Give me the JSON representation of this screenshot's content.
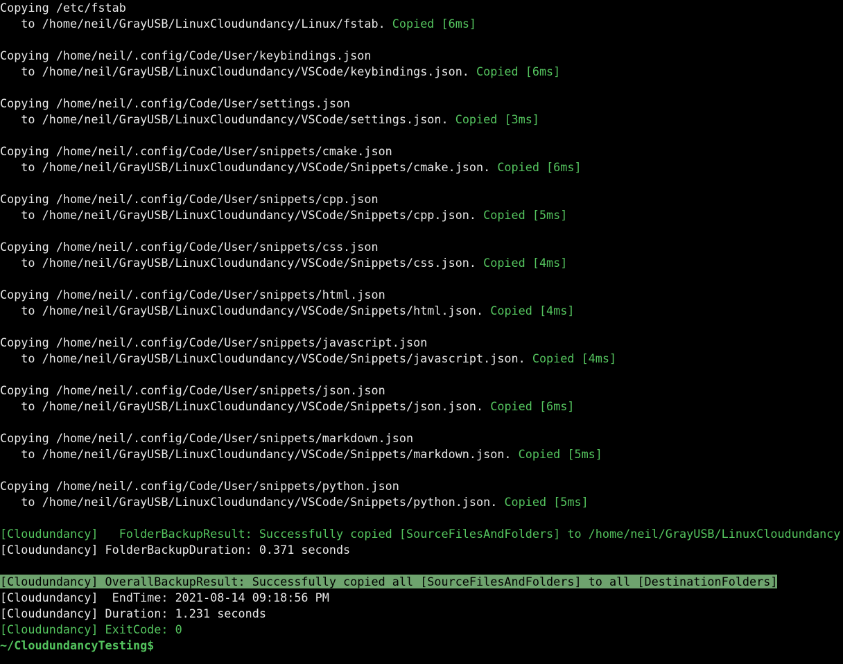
{
  "copies": [
    {
      "src": "Copying /etc/fstab",
      "dst": "   to /home/neil/GrayUSB/LinuxCloudundancy/Linux/fstab. ",
      "status": "Copied [6ms]"
    },
    {
      "src": "Copying /home/neil/.config/Code/User/keybindings.json",
      "dst": "   to /home/neil/GrayUSB/LinuxCloudundancy/VSCode/keybindings.json. ",
      "status": "Copied [6ms]"
    },
    {
      "src": "Copying /home/neil/.config/Code/User/settings.json",
      "dst": "   to /home/neil/GrayUSB/LinuxCloudundancy/VSCode/settings.json. ",
      "status": "Copied [3ms]"
    },
    {
      "src": "Copying /home/neil/.config/Code/User/snippets/cmake.json",
      "dst": "   to /home/neil/GrayUSB/LinuxCloudundancy/VSCode/Snippets/cmake.json. ",
      "status": "Copied [6ms]"
    },
    {
      "src": "Copying /home/neil/.config/Code/User/snippets/cpp.json",
      "dst": "   to /home/neil/GrayUSB/LinuxCloudundancy/VSCode/Snippets/cpp.json. ",
      "status": "Copied [5ms]"
    },
    {
      "src": "Copying /home/neil/.config/Code/User/snippets/css.json",
      "dst": "   to /home/neil/GrayUSB/LinuxCloudundancy/VSCode/Snippets/css.json. ",
      "status": "Copied [4ms]"
    },
    {
      "src": "Copying /home/neil/.config/Code/User/snippets/html.json",
      "dst": "   to /home/neil/GrayUSB/LinuxCloudundancy/VSCode/Snippets/html.json. ",
      "status": "Copied [4ms]"
    },
    {
      "src": "Copying /home/neil/.config/Code/User/snippets/javascript.json",
      "dst": "   to /home/neil/GrayUSB/LinuxCloudundancy/VSCode/Snippets/javascript.json. ",
      "status": "Copied [4ms]"
    },
    {
      "src": "Copying /home/neil/.config/Code/User/snippets/json.json",
      "dst": "   to /home/neil/GrayUSB/LinuxCloudundancy/VSCode/Snippets/json.json. ",
      "status": "Copied [6ms]"
    },
    {
      "src": "Copying /home/neil/.config/Code/User/snippets/markdown.json",
      "dst": "   to /home/neil/GrayUSB/LinuxCloudundancy/VSCode/Snippets/markdown.json. ",
      "status": "Copied [5ms]"
    },
    {
      "src": "Copying /home/neil/.config/Code/User/snippets/python.json",
      "dst": "   to /home/neil/GrayUSB/LinuxCloudundancy/VSCode/Snippets/python.json. ",
      "status": "Copied [5ms]"
    }
  ],
  "folder_result": "[Cloudundancy]   FolderBackupResult: Successfully copied [SourceFilesAndFolders] to /home/neil/GrayUSB/LinuxCloudundancy",
  "folder_duration": "[Cloudundancy] FolderBackupDuration: 0.371 seconds",
  "overall_result": "[Cloudundancy] OverallBackupResult: Successfully copied all [SourceFilesAndFolders] to all [DestinationFolders]",
  "end_time": "[Cloudundancy]  EndTime: 2021-08-14 09:18:56 PM",
  "duration": "[Cloudundancy] Duration: 1.231 seconds",
  "exit_code": "[Cloudundancy] ExitCode: 0",
  "prompt": "~/CloudundancyTesting$"
}
